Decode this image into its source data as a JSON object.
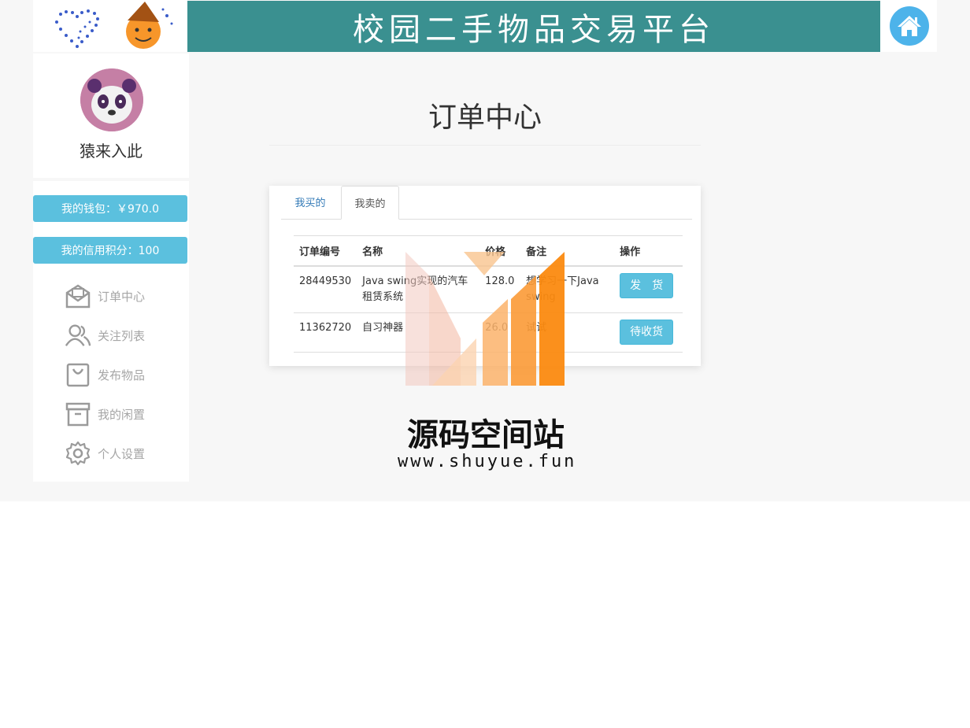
{
  "header": {
    "banner_title": "校园二手物品交易平台",
    "home_icon": "home-icon"
  },
  "profile": {
    "username": "猿来入此"
  },
  "sidebar": {
    "wallet_label": "我的钱包：￥970.0",
    "credit_label": "我的信用积分：100",
    "items": [
      {
        "label": "订单中心",
        "icon": "envelope-icon"
      },
      {
        "label": "关注列表",
        "icon": "users-icon"
      },
      {
        "label": "发布物品",
        "icon": "bag-icon"
      },
      {
        "label": "我的闲置",
        "icon": "archive-icon"
      },
      {
        "label": "个人设置",
        "icon": "gear-icon"
      }
    ]
  },
  "main": {
    "title": "订单中心",
    "tabs": [
      {
        "label": "我买的"
      },
      {
        "label": "我卖的"
      }
    ],
    "table": {
      "headers": [
        "订单编号",
        "名称",
        "价格",
        "备注",
        "操作"
      ],
      "rows": [
        {
          "id": "28449530",
          "name": "Java swing实现的汽车租赁系统",
          "price": "128.0",
          "note": "想学习一下Java swing",
          "action": "发　货"
        },
        {
          "id": "11362720",
          "name": "自习神器",
          "price": "26.0",
          "note": "试试",
          "action": "待收货"
        }
      ]
    }
  },
  "watermark": {
    "text": "源码空间站",
    "url": "www.shuyue.fun"
  }
}
